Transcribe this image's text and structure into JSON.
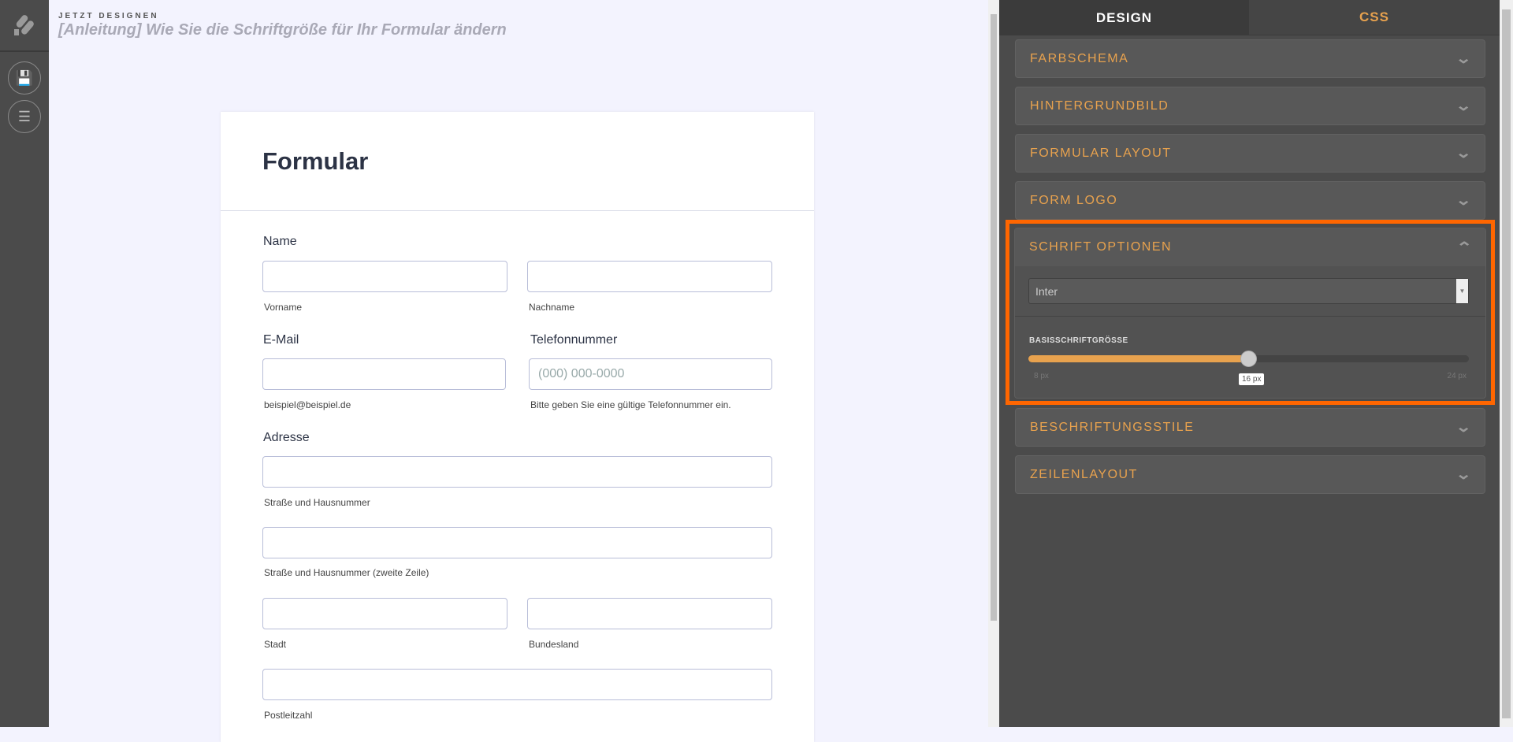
{
  "header": {
    "kicker": "JETZT DESIGNEN",
    "title": "[Anleitung] Wie Sie die Schriftgröße für Ihr Formular ändern"
  },
  "form": {
    "title": "Formular",
    "name_label": "Name",
    "first_sub": "Vorname",
    "last_sub": "Nachname",
    "email_label": "E-Mail",
    "email_sub": "beispiel@beispiel.de",
    "phone_label": "Telefonnummer",
    "phone_placeholder": "(000) 000-0000",
    "phone_sub": "Bitte geben Sie eine gültige Telefonnummer ein.",
    "address_label": "Adresse",
    "street_sub": "Straße und Hausnummer",
    "street2_sub": "Straße und Hausnummer (zweite Zeile)",
    "city_sub": "Stadt",
    "state_sub": "Bundesland",
    "zip_sub": "Postleitzahl"
  },
  "panel": {
    "tabs": [
      {
        "label": "DESIGN",
        "active": true
      },
      {
        "label": "CSS",
        "active": false
      }
    ],
    "sections": [
      "FARBSCHEMA",
      "HINTERGRUNDBILD",
      "FORMULAR LAYOUT",
      "FORM LOGO"
    ],
    "font_options": {
      "title": "SCHRIFT OPTIONEN",
      "font": "Inter",
      "size_label": "BASISSCHRIFTGRÖSSE",
      "min": "8 px",
      "max": "24 px",
      "value": "16 px",
      "fraction": 0.5
    },
    "sections_after": [
      "BESCHRIFTUNGSSTILE",
      "ZEILENLAYOUT"
    ]
  },
  "colors": {
    "accent": "#e8a24e",
    "highlight": "#ff6600"
  }
}
